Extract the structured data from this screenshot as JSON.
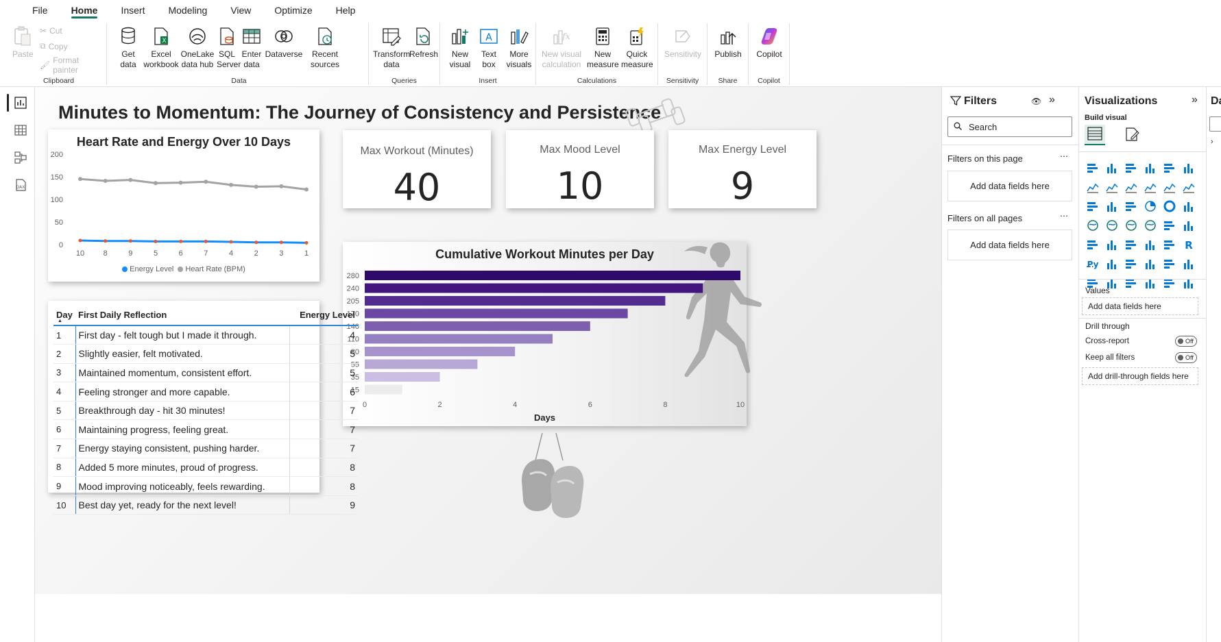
{
  "menu": {
    "items": [
      "File",
      "Home",
      "Insert",
      "Modeling",
      "View",
      "Optimize",
      "Help"
    ],
    "active": "Home"
  },
  "ribbon": {
    "clipboard": {
      "label": "Clipboard",
      "paste": "Paste",
      "cut": "Cut",
      "copy": "Copy",
      "format_painter": "Format painter"
    },
    "data": {
      "label": "Data",
      "get_data": "Get data",
      "excel": "Excel workbook",
      "onelake": "OneLake data hub",
      "sql": "SQL Server",
      "enter": "Enter data",
      "dataverse": "Dataverse",
      "recent": "Recent sources"
    },
    "queries": {
      "label": "Queries",
      "transform": "Transform data",
      "refresh": "Refresh"
    },
    "insert": {
      "label": "Insert",
      "new_visual": "New visual",
      "text_box": "Text box",
      "more_visuals": "More visuals"
    },
    "calculations": {
      "label": "Calculations",
      "new_visual_calc": "New visual calculation",
      "new_measure": "New measure",
      "quick_measure": "Quick measure"
    },
    "sensitivity": {
      "label": "Sensitivity",
      "btn": "Sensitivity"
    },
    "share": {
      "label": "Share",
      "publish": "Publish"
    },
    "copilot": {
      "label": "Copilot",
      "btn": "Copilot"
    }
  },
  "report": {
    "title": "Minutes to Momentum: The Journey of Consistency and Persistence",
    "kpis": [
      {
        "label": "Max Workout (Minutes)",
        "value": "40"
      },
      {
        "label": "Max Mood Level",
        "value": "10"
      },
      {
        "label": "Max Energy Level",
        "value": "9"
      }
    ],
    "line_chart": {
      "title": "Heart Rate and Energy Over 10 Days",
      "legend": [
        "Energy Level",
        "Heart Rate (BPM)"
      ]
    },
    "bar_chart": {
      "title": "Cumulative Workout Minutes per Day",
      "xlabel": "Days"
    },
    "table": {
      "headers": [
        "Day",
        "First Daily Reflection",
        "Energy Level"
      ],
      "rows": [
        [
          "1",
          "First day - felt tough but I made it through.",
          "4"
        ],
        [
          "2",
          "Slightly easier, felt motivated.",
          "5"
        ],
        [
          "3",
          "Maintained momentum, consistent effort.",
          "5"
        ],
        [
          "4",
          "Feeling stronger and more capable.",
          "6"
        ],
        [
          "5",
          "Breakthrough day - hit 30 minutes!",
          "7"
        ],
        [
          "6",
          "Maintaining progress, feeling great.",
          "7"
        ],
        [
          "7",
          "Energy staying consistent, pushing harder.",
          "7"
        ],
        [
          "8",
          "Added 5 more minutes, proud of progress.",
          "8"
        ],
        [
          "9",
          "Mood improving noticeably, feels rewarding.",
          "8"
        ],
        [
          "10",
          "Best day yet, ready for the next level!",
          "9"
        ]
      ]
    }
  },
  "chart_data": [
    {
      "type": "line",
      "title": "Heart Rate and Energy Over 10 Days",
      "x": [
        "10",
        "8",
        "9",
        "5",
        "6",
        "7",
        "4",
        "2",
        "3",
        "1"
      ],
      "ylim": [
        0,
        200
      ],
      "yticks": [
        0,
        50,
        100,
        150,
        200
      ],
      "series": [
        {
          "name": "Heart Rate (BPM)",
          "color": "#a0a5a3",
          "values": [
            145,
            141,
            143,
            136,
            137,
            139,
            132,
            128,
            129,
            122
          ]
        },
        {
          "name": "Energy Level",
          "color": "#118dff",
          "values": [
            9,
            8,
            8,
            7,
            7,
            7,
            6,
            5,
            5,
            4
          ]
        }
      ],
      "legend_position": "bottom"
    },
    {
      "type": "bar",
      "orientation": "horizontal",
      "title": "Cumulative Workout Minutes per Day",
      "xlabel": "Days",
      "categories": [
        "280",
        "240",
        "205",
        "170",
        "140",
        "110",
        "80",
        "55",
        "35",
        "15"
      ],
      "values": [
        10,
        9,
        8,
        7,
        6,
        5,
        4,
        3,
        2,
        1
      ],
      "xlim": [
        0,
        10
      ],
      "xticks": [
        0,
        2,
        4,
        6,
        8,
        10
      ],
      "colors": [
        "#2e0a6a",
        "#42157f",
        "#532c90",
        "#6a48a4",
        "#7d5fb0",
        "#9480c0",
        "#a693cb",
        "#b7a8d5",
        "#cbbde3",
        "#ececec"
      ]
    }
  ],
  "filters": {
    "title": "Filters",
    "search_placeholder": "Search",
    "on_this_page": "Filters on this page",
    "on_all_pages": "Filters on all pages",
    "add_fields": "Add data fields here"
  },
  "visualizations": {
    "title": "Visualizations",
    "build_visual": "Build visual",
    "values": "Values",
    "add_fields": "Add data fields here",
    "drill_through": "Drill through",
    "cross_report": "Cross-report",
    "keep_all_filters": "Keep all filters",
    "toggle_off": "Off",
    "add_drill": "Add drill-through fields here",
    "more": "..."
  },
  "data_pane": {
    "title": "Dat"
  }
}
